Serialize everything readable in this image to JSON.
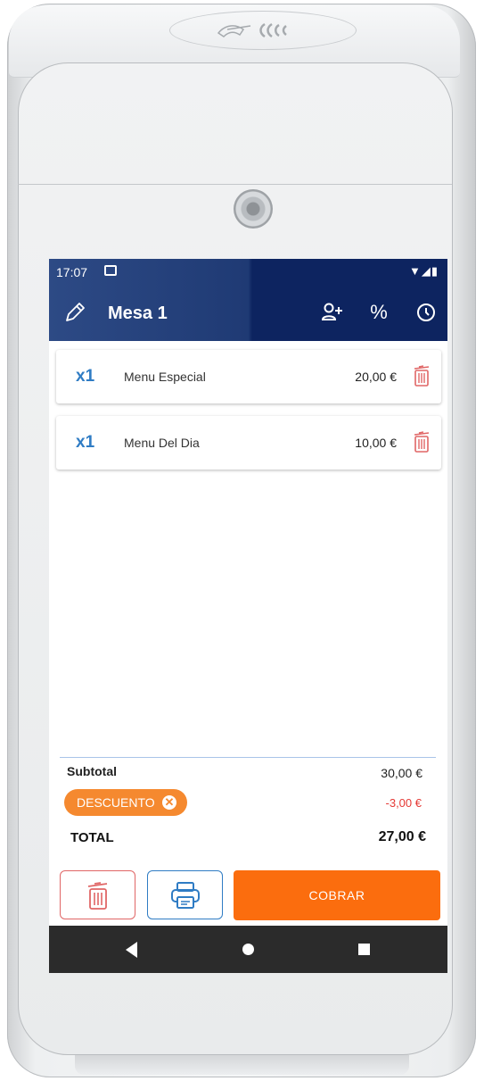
{
  "status_bar": {
    "time": "17:07",
    "notification_icon": "gmail-icon",
    "system_icons": "▼◢▮"
  },
  "app_bar": {
    "title": "Mesa 1",
    "actions": [
      "add-customer-icon",
      "percent-icon",
      "clock-icon"
    ],
    "percent_symbol": "%"
  },
  "order_items": [
    {
      "qty": "x1",
      "name": "Menu Especial",
      "price": "20,00 €"
    },
    {
      "qty": "x1",
      "name": "Menu Del Dia",
      "price": "10,00 €"
    }
  ],
  "totals": {
    "subtotal_label": "Subtotal",
    "subtotal_value": "30,00 €",
    "discount_chip": "DESCUENTO",
    "discount_value": "-3,00 €",
    "total_label": "TOTAL",
    "total_value": "27,00 €"
  },
  "actions": {
    "cobrar_label": "COBRAR"
  },
  "colors": {
    "header": "#1f3a74",
    "accent_orange": "#fb6d0e",
    "chip_orange": "#f5892f",
    "qty_blue": "#2f7cc4",
    "delete_red": "#e06666",
    "discount_red": "#e53935"
  }
}
